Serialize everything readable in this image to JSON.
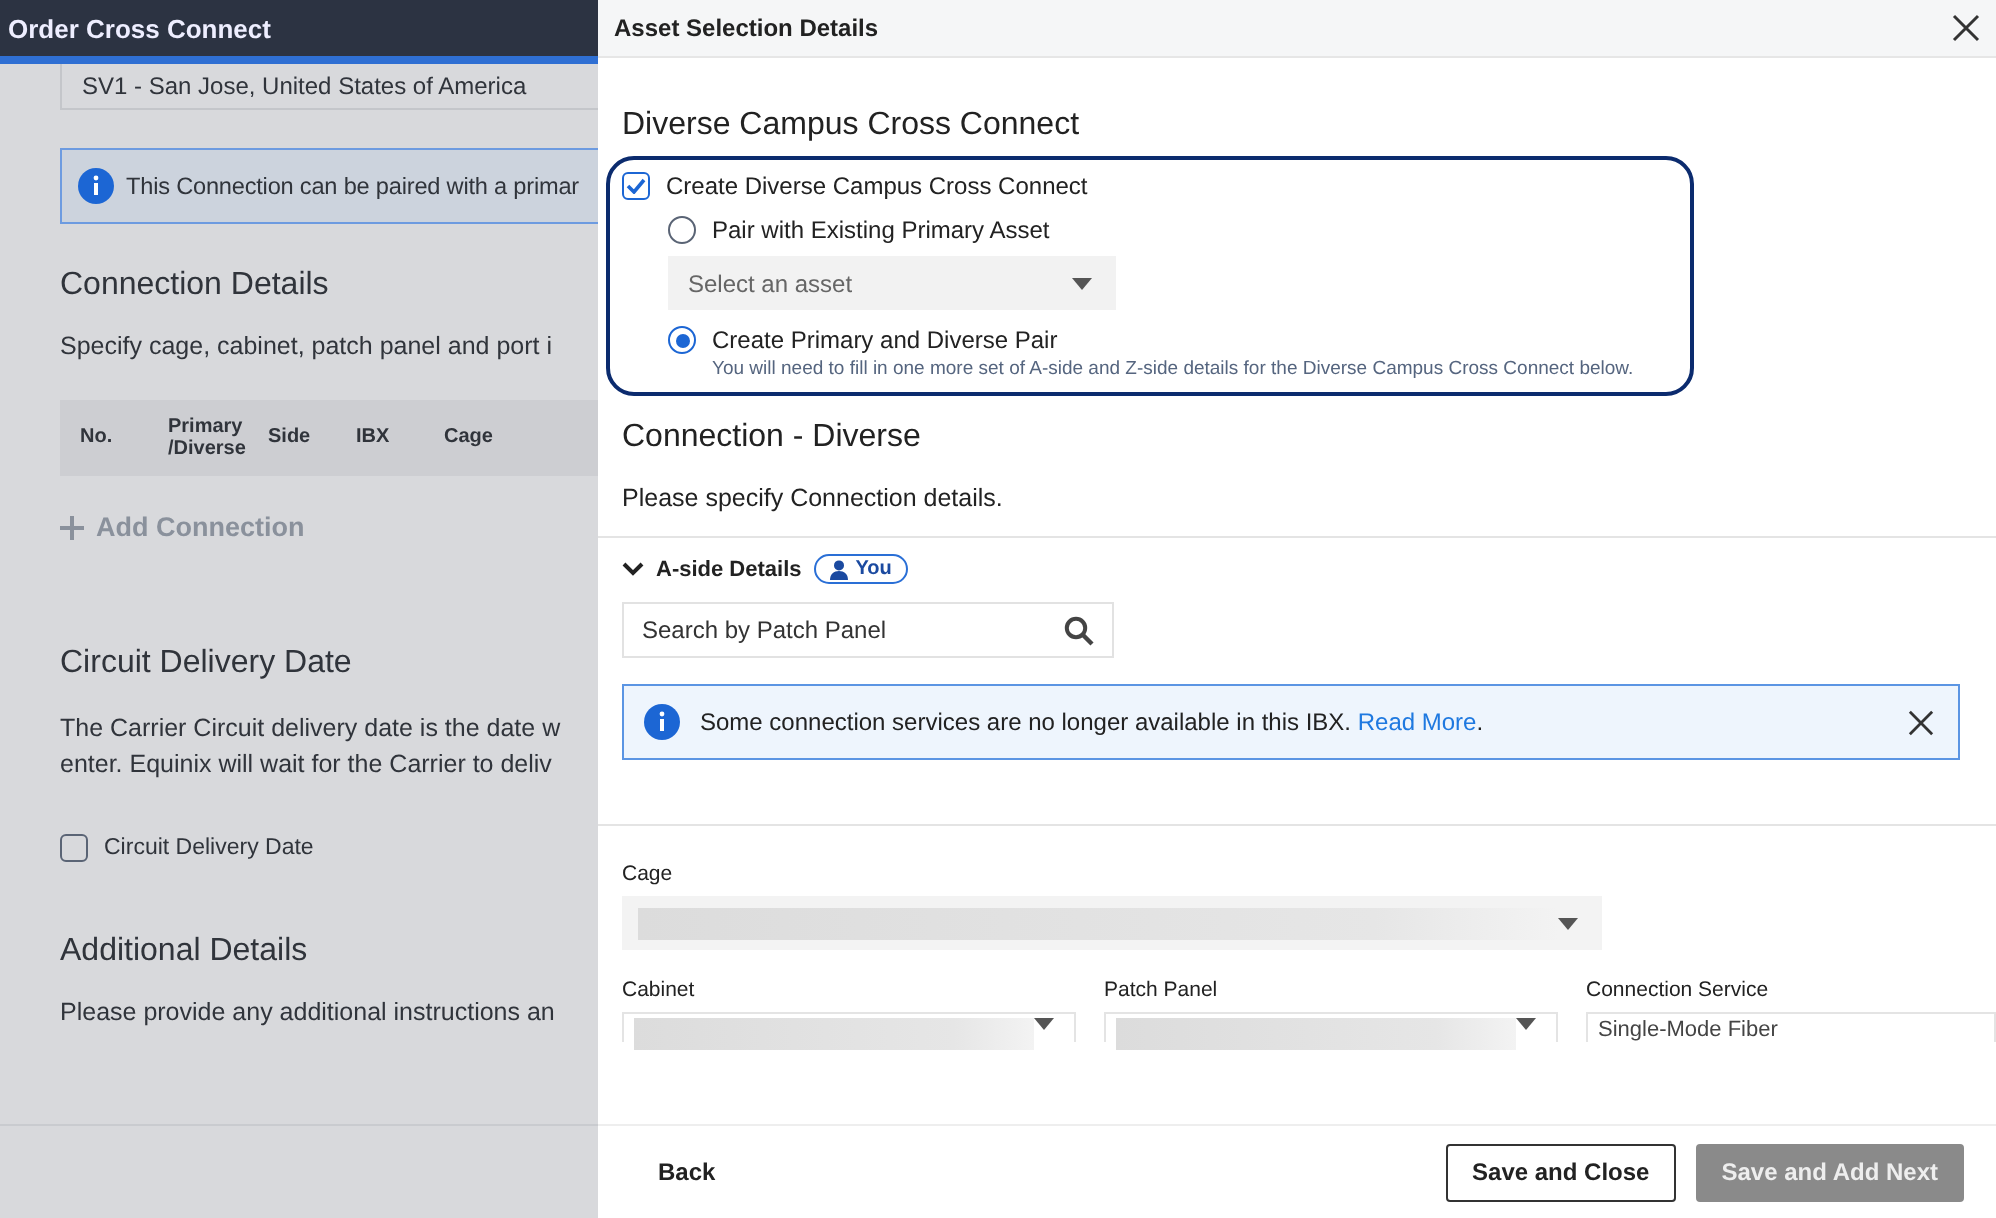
{
  "app_header": {
    "title": "Order Cross Connect"
  },
  "background_form": {
    "location_value": "SV1 - San Jose, United States of America",
    "info_banner": "This Connection can be paired with a primar",
    "connection_details": {
      "title": "Connection Details",
      "description": "Specify cage, cabinet, patch panel and port i",
      "columns": [
        "No.",
        "Primary /Diverse",
        "Side",
        "IBX",
        "Cage"
      ],
      "add_action": "Add Connection"
    },
    "circuit_delivery": {
      "title": "Circuit Delivery Date",
      "lines": [
        "The Carrier Circuit delivery date is the date w",
        "enter. Equinix will wait for the Carrier to deliv"
      ],
      "checkbox": {
        "label": "Circuit Delivery Date",
        "checked": false
      }
    },
    "additional_details": {
      "title": "Additional Details",
      "description": "Please provide any additional instructions an"
    }
  },
  "drawer": {
    "title": "Asset Selection Details",
    "diverse_section": {
      "title": "Diverse Campus Cross Connect",
      "checkbox": {
        "label": "Create Diverse Campus Cross Connect",
        "checked": true
      },
      "options": [
        {
          "label": "Pair with Existing Primary Asset",
          "selected": false
        },
        {
          "label": "Create Primary and Diverse Pair",
          "selected": true,
          "hint": "You will need to fill in one more set of A-side and Z-side details for the Diverse Campus Cross Connect below."
        }
      ],
      "asset_select": {
        "placeholder": "Select an asset"
      }
    },
    "connection": {
      "title": "Connection - Diverse",
      "description": "Please specify Connection details."
    },
    "a_side": {
      "title": "A-side Details",
      "expanded": true,
      "badge": "You",
      "search": {
        "placeholder": "Search by Patch Panel"
      },
      "notice": {
        "text": "Some connection services are no longer available in this IBX.",
        "link": "Read More",
        "suffix": "."
      },
      "fields": [
        {
          "label": "Cage",
          "kind": "redacted"
        },
        {
          "label": "Cabinet",
          "kind": "redacted"
        },
        {
          "label": "Patch Panel",
          "kind": "redacted"
        },
        {
          "label": "Connection Service",
          "kind": "text",
          "value": "Single-Mode Fiber"
        }
      ]
    },
    "buttons": [
      {
        "label": "Back",
        "kind": "link",
        "disabled": false
      },
      {
        "label": "Save and Close",
        "kind": "outline",
        "disabled": false
      },
      {
        "label": "Save and Add Next",
        "kind": "primary",
        "disabled": true
      }
    ]
  }
}
